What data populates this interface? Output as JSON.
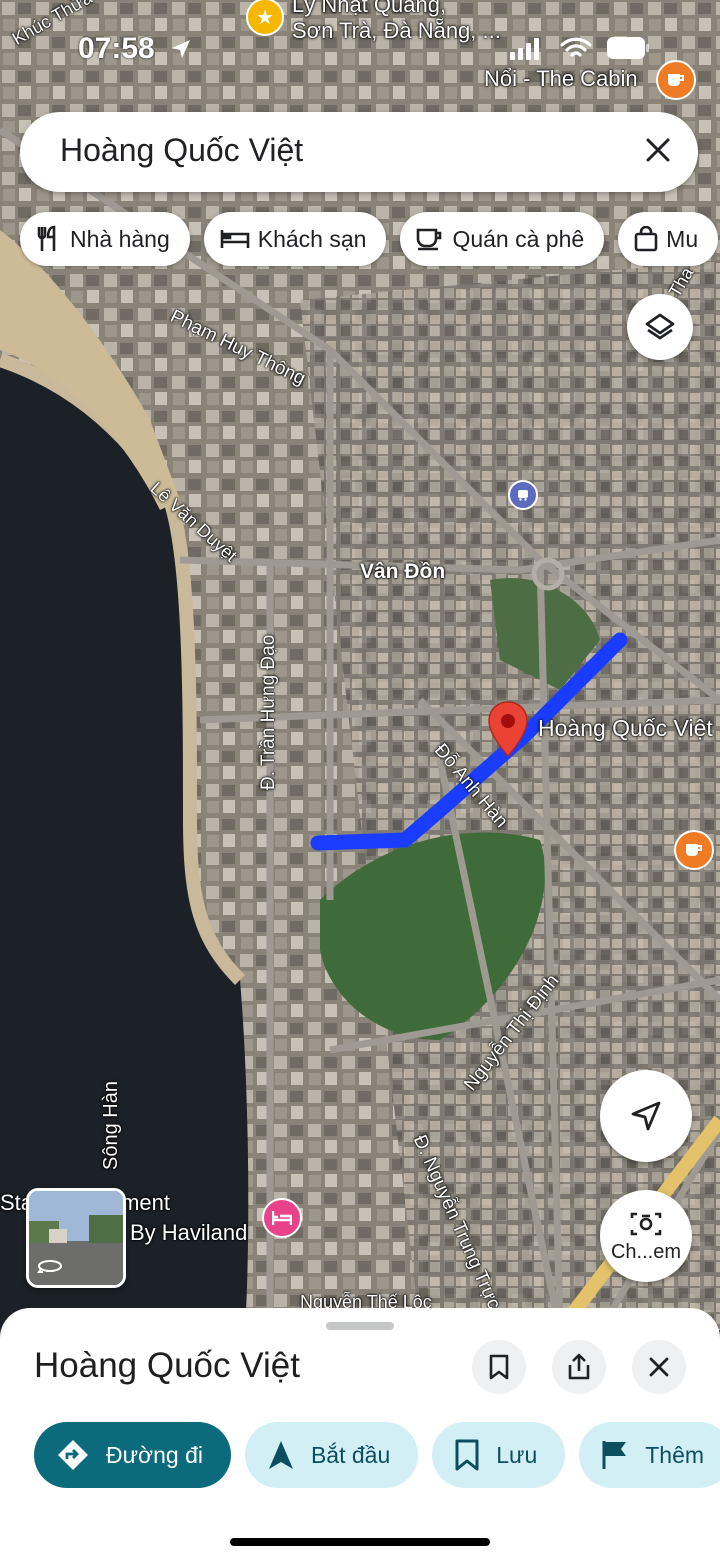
{
  "status": {
    "time": "07:58"
  },
  "search": {
    "query": "Hoàng Quốc Việt"
  },
  "chips": [
    {
      "label": "Nhà hàng",
      "icon": "restaurant-icon"
    },
    {
      "label": "Khách sạn",
      "icon": "hotel-icon"
    },
    {
      "label": "Quán cà phê",
      "icon": "coffee-icon"
    },
    {
      "label": "Mu",
      "icon": "shopping-bag-icon"
    }
  ],
  "map_labels": {
    "top_place": "Lý Nhật Quang,",
    "top_place_2": "Sơn Trà, Đà Nẵng, ...",
    "khuc_thua": "Khúc Thừa",
    "cabin": "Nổi - The Cabin",
    "pham_huy_thong": "Phạm Huy Thông",
    "le_van_duyet": "Lê Văn Duyệt",
    "van_don": "Vân Đồn",
    "tran_hung_dao": "Đ. Trần Hưng Đạo",
    "do_anh_han": "Đỗ Anh Hàn",
    "pin_label": "Hoàng Quốc Việt",
    "nguyen_thi_dinh": "Nguyễn Thị Định",
    "nguyen_trung_truc": "Đ. Nguyễn Trung Trực",
    "song_han": "Sông Hàn",
    "apartment_1": "Star   el Apartment",
    "apartment_2": "By Haviland",
    "nguyen_the_loc": "Nguyễn Thế Lộc",
    "tha": "Tha"
  },
  "camera_search": {
    "label": "Ch...em"
  },
  "sheet": {
    "title": "Hoàng Quốc Việt",
    "actions": [
      {
        "label": "Đường đi",
        "icon": "directions-icon"
      },
      {
        "label": "Bắt đầu",
        "icon": "navigation-arrow-icon"
      },
      {
        "label": "Lưu",
        "icon": "bookmark-icon"
      },
      {
        "label": "Thêm",
        "icon": "flag-icon"
      }
    ]
  },
  "colors": {
    "route": "#1a3cff",
    "pin": "#ea4335",
    "primary": "#0b6a7c",
    "chip_bg": "#ffffff"
  }
}
